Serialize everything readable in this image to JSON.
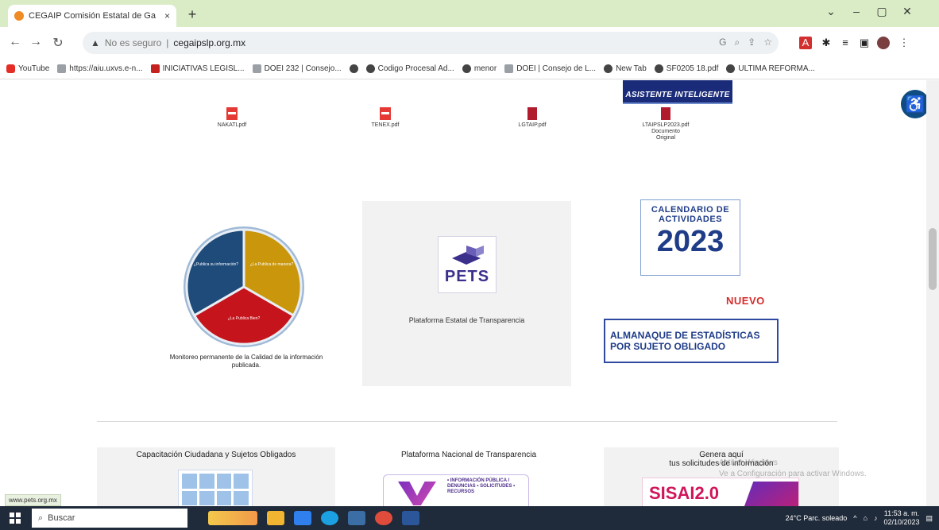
{
  "browser": {
    "tab_title": "CEGAIP Comisión Estatal de Ga",
    "tab_close": "×",
    "new_tab": "+",
    "security_label": "No es seguro",
    "url": "cegaipslp.org.mx",
    "window_controls": [
      "⌄",
      "–",
      "▢",
      "✕"
    ],
    "bookmarks": [
      {
        "label": "YouTube",
        "icon": "youtube-icon"
      },
      {
        "label": "https://aiu.uxvs.e-n...",
        "icon": "apps-icon"
      },
      {
        "label": "INICIATIVAS LEGISL...",
        "icon": "gmail-icon"
      },
      {
        "label": "DOEI 232 | Consejo...",
        "icon": "gf-icon"
      },
      {
        "label": "",
        "icon": "globe-icon"
      },
      {
        "label": "Codigo Procesal Ad...",
        "icon": "globe-icon"
      },
      {
        "label": "menor",
        "icon": "globe-icon"
      },
      {
        "label": "DOEI | Consejo de L...",
        "icon": "gf-icon"
      },
      {
        "label": "New Tab",
        "icon": "globe-icon"
      },
      {
        "label": "SF0205 18.pdf",
        "icon": "globe-icon"
      },
      {
        "label": "ULTIMA REFORMA...",
        "icon": "globe-icon"
      }
    ]
  },
  "page": {
    "docs": [
      {
        "label": "NAKATLpdf",
        "type": "pdf"
      },
      {
        "label": "TENEX.pdf",
        "type": "pdf"
      },
      {
        "label": "LGTAIP.pdf",
        "type": "doc"
      },
      {
        "label": "LTAIPSLP2023.pdf Documento Original",
        "type": "doc"
      }
    ],
    "asistente_banner": "ASISTENTE INTELIGENTE",
    "pie_segments": [
      {
        "label": "¿Publica su información?",
        "color": "#1e4b7a"
      },
      {
        "label": "¿La Publica de manera?",
        "color": "#c9960c"
      },
      {
        "label": "¿La Publica Bien?",
        "color": "#c5141b"
      }
    ],
    "pie_caption": "Monitoreo permanente de la Calidad de la información publicada.",
    "pets_word": "PETS",
    "pets_caption": "Plataforma Estatal de Transparencia",
    "calendar_title": "CALENDARIO DE ACTIVIDADES",
    "calendar_year": "2023",
    "nuevo": "NUEVO",
    "almanaque": "ALMANAQUE DE ESTADÍSTICAS POR SUJETO OBLIGADO",
    "card_capacitacion": "Capacitación Ciudadana y Sujetos Obligados",
    "card_pnt": "Plataforma Nacional de Transparencia",
    "pnt_items": "• INFORMACIÓN PÚBLICA / DENUNCIAS • SOLICITUDES • RECURSOS",
    "card_genera_line1": "Genera aquí",
    "card_genera_line2": "tus solicitudes de información",
    "sisai": "SISAI2.0",
    "windows_watermark_1": "Activar Windows",
    "windows_watermark_2": "Ve a Configuración para activar Windows.",
    "status_url": "www.pets.org.mx"
  },
  "taskbar": {
    "search_placeholder": "Buscar",
    "weather": "24°C  Parc. soleado",
    "time": "11:53 a. m.",
    "date": "02/10/2023"
  }
}
